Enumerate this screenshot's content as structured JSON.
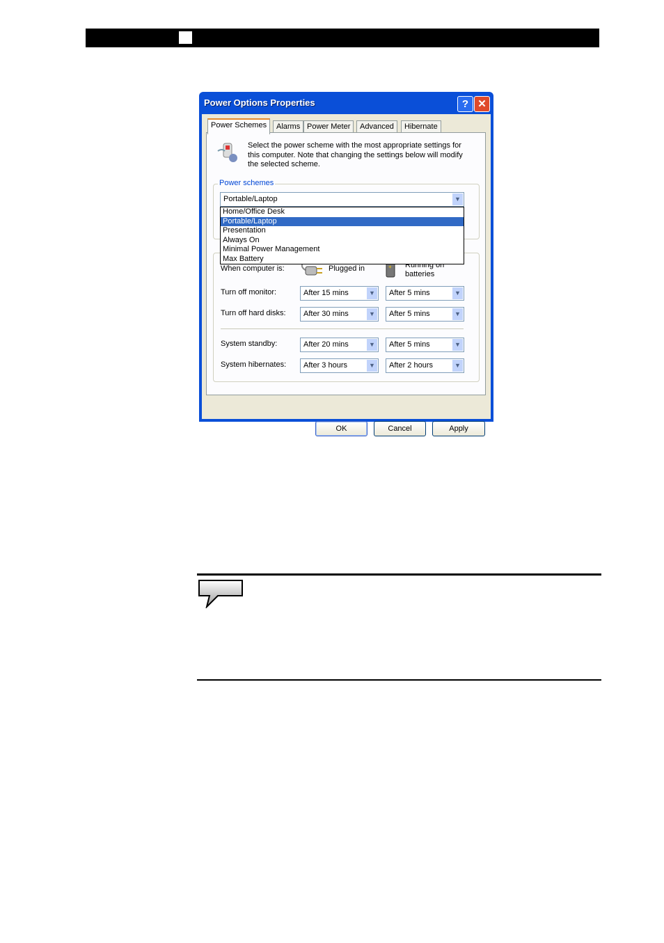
{
  "dialog": {
    "title": "Power Options Properties",
    "help_glyph": "?",
    "close_glyph": "✕",
    "tabs": [
      "Power Schemes",
      "Alarms",
      "Power Meter",
      "Advanced",
      "Hibernate"
    ],
    "active_tab": "Power Schemes",
    "description": "Select the power scheme with the most appropriate settings for this computer. Note that changing the settings below will modify the selected scheme.",
    "schemes_group_label": "Power schemes",
    "scheme_selected": "Portable/Laptop",
    "scheme_options": [
      "Home/Office Desk",
      "Portable/Laptop",
      "Presentation",
      "Always On",
      "Minimal Power Management",
      "Max Battery"
    ],
    "when_label": "When computer is:",
    "plugged_label": "Plugged in",
    "battery_label_1": "Running on",
    "battery_label_2": "batteries",
    "settings": [
      {
        "label": "Turn off monitor:",
        "plugged": "After 15 mins",
        "battery": "After 5 mins"
      },
      {
        "label": "Turn off hard disks:",
        "plugged": "After 30 mins",
        "battery": "After 5 mins"
      },
      {
        "label": "System standby:",
        "plugged": "After 20 mins",
        "battery": "After 5 mins"
      },
      {
        "label": "System hibernates:",
        "plugged": "After 3 hours",
        "battery": "After 2 hours"
      }
    ],
    "buttons": {
      "ok": "OK",
      "cancel": "Cancel",
      "apply": "Apply"
    },
    "icons": {
      "power-scheme": "power-scheme-icon",
      "plug": "plug-icon",
      "battery": "battery-icon",
      "note": "speech-bubble-icon"
    },
    "colors": {
      "titlebar": "#0a4fd8",
      "selection": "#316ac5",
      "group_label": "#0046d5"
    }
  }
}
